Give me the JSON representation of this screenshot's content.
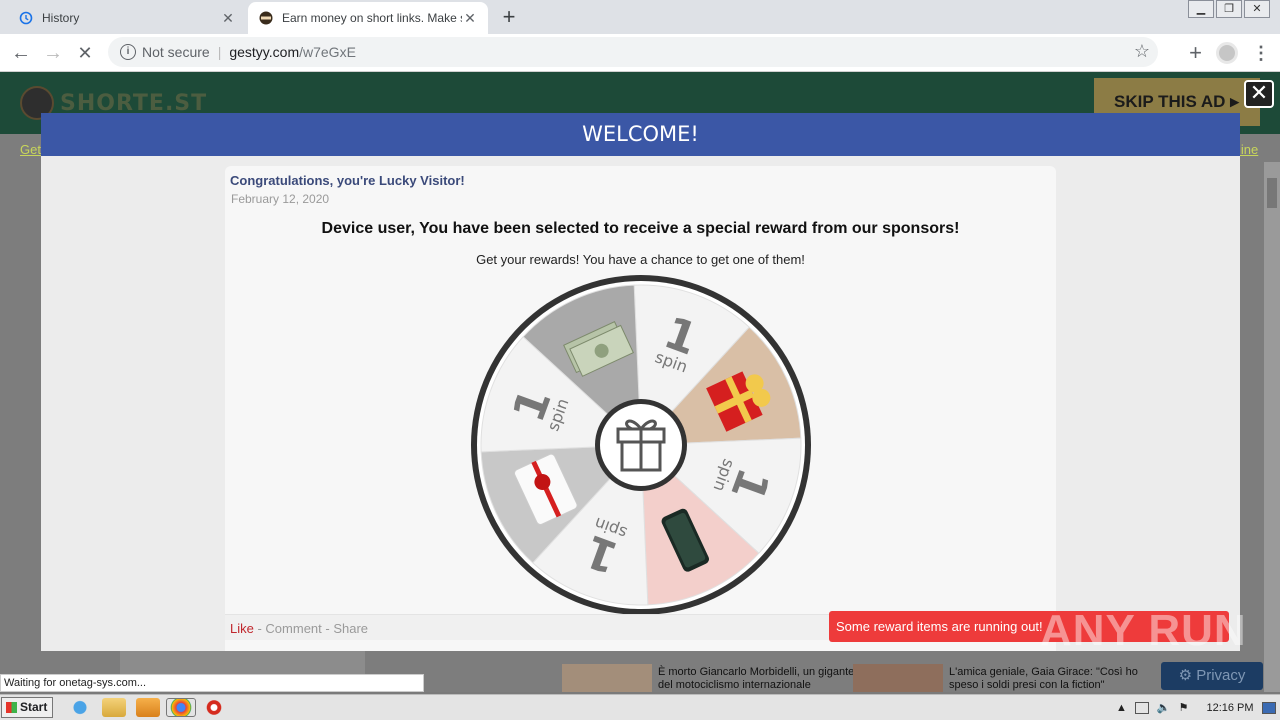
{
  "browser": {
    "tabs": [
      {
        "title": "History",
        "active": false
      },
      {
        "title": "Earn money on short links. Make sho",
        "active": true
      }
    ],
    "address": {
      "security": "Not secure",
      "host": "gestyy.com",
      "path": "/w7eGxE"
    }
  },
  "site": {
    "logo_text": "SHORTE.ST",
    "skip_label": "SKIP THIS AD",
    "close_glyph": "✕",
    "nav_left": "Get",
    "nav_right": "line",
    "privacy_label": "Privacy",
    "news": [
      {
        "headline": "È morto Giancarlo Morbidelli, un gigante del motociclismo internazionale"
      },
      {
        "headline": "L'amica geniale, Gaia Girace: \"Così ho speso i soldi presi con la fiction\""
      }
    ]
  },
  "modal": {
    "title": "WELCOME!",
    "congrats": "Congratulations, you're Lucky Visitor!",
    "date": "February 12, 2020",
    "headline": "Device user, You have been selected to receive a special reward from our sponsors!",
    "sub": "Get your rewards! You have a chance to get one of them!",
    "wheel": {
      "segments": [
        {
          "label": "1 spin",
          "color": "#f3f3f3",
          "icon": "spin-text"
        },
        {
          "label": "gift-box",
          "color": "#d9bfa6",
          "icon": "gift-box-icon"
        },
        {
          "label": "1 spin",
          "color": "#f3f3f3",
          "icon": "spin-text"
        },
        {
          "label": "smartphone",
          "color": "#f3cfcb",
          "icon": "smartphone-icon"
        },
        {
          "label": "1 spin",
          "color": "#f3f3f3",
          "icon": "spin-text"
        },
        {
          "label": "gift-card",
          "color": "#c8c8c8",
          "icon": "gift-card-icon"
        },
        {
          "label": "1 spin",
          "color": "#f3f3f3",
          "icon": "spin-text"
        },
        {
          "label": "cash",
          "color": "#a9a9a9",
          "icon": "cash-icon"
        }
      ],
      "spin_number": "1",
      "spin_word": "spin"
    },
    "social": {
      "like": "Like",
      "comment": "Comment",
      "share": "Share",
      "separator": " - "
    }
  },
  "toast": "Some reward items are running out!",
  "watermark": "ANY RUN",
  "status_text": "Waiting for onetag-sys.com...",
  "taskbar": {
    "start_label": "Start",
    "clock": "12:16 PM"
  }
}
